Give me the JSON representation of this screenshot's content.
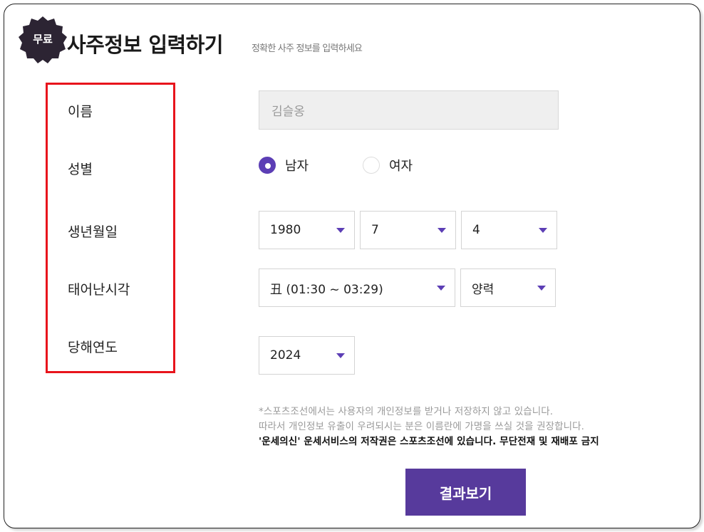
{
  "header": {
    "badge": "무료",
    "title": "사주정보 입력하기",
    "subtitle": "정확한 사주 정보를 입력하세요"
  },
  "labels": {
    "name": "이름",
    "gender": "성별",
    "birthdate": "생년월일",
    "birth_time": "태어난시각",
    "target_year": "당해연도"
  },
  "form": {
    "name_placeholder": "김슬옹",
    "gender_options": [
      {
        "label": "남자",
        "checked": true
      },
      {
        "label": "여자",
        "checked": false
      }
    ],
    "birth_year": "1980",
    "birth_month": "7",
    "birth_day": "4",
    "birth_time": "丑 (01:30 ~ 03:29)",
    "calendar_type": "양력",
    "target_year": "2024"
  },
  "notice": {
    "line1": "*스포츠조선에서는 사용자의 개인정보를 받거나 저장하지 않고 있습니다.",
    "line2": "따라서 개인정보 유출이 우려되시는 분은 이름란에 가명을 쓰실 것을 권장합니다.",
    "line3": "'운세의신' 운세서비스의 저작권은 스포츠조선에 있습니다. 무단전재 및 재배포 금지"
  },
  "submit_label": "결과보기",
  "colors": {
    "accent": "#5c3eb5",
    "button": "#573a9c",
    "badge": "#2c2433",
    "highlight_box": "#e8141c"
  }
}
